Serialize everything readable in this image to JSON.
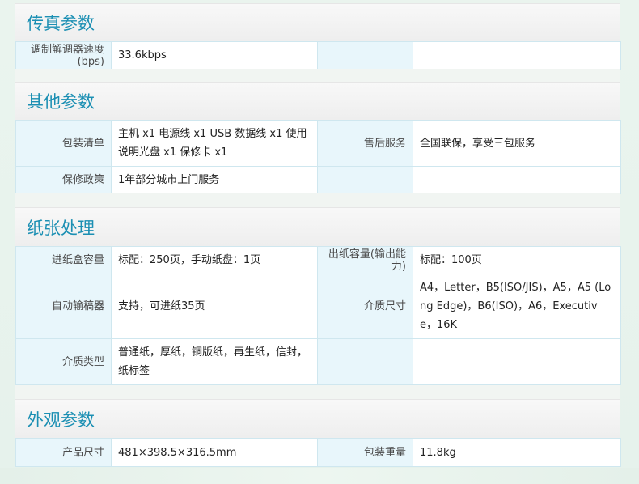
{
  "sections": {
    "fax": {
      "title": "传真参数",
      "rows": [
        {
          "label": "调制解调器速度(bps)",
          "value": "33.6kbps"
        }
      ]
    },
    "other": {
      "title": "其他参数",
      "rows": [
        {
          "label1": "包装清单",
          "value1": "主机 x1 电源线 x1 USB 数据线 x1 使用说明光盘 x1 保修卡 x1",
          "label2": "售后服务",
          "value2": "全国联保，享受三包服务"
        },
        {
          "label1": "保修政策",
          "value1": "1年部分城市上门服务"
        }
      ]
    },
    "paper": {
      "title": "纸张处理",
      "rows": [
        {
          "label1": "进纸盒容量",
          "value1": "标配：250页，手动纸盘：1页",
          "label2": "出纸容量(输出能力)",
          "value2": "标配：100页"
        },
        {
          "label1": "自动输稿器",
          "value1": "支持，可进纸35页",
          "label2": "介质尺寸",
          "value2": "A4，Letter，B5(ISO/JIS)，A5，A5 (Long Edge)，B6(ISO)，A6，Executive，16K"
        },
        {
          "label1": "介质类型",
          "value1": "普通纸，厚纸，铜版纸，再生纸，信封，纸标签"
        }
      ]
    },
    "appearance": {
      "title": "外观参数",
      "rows": [
        {
          "label1": "产品尺寸",
          "value1": "481×398.5×316.5mm",
          "label2": "包装重量",
          "value2": "11.8kg"
        }
      ]
    }
  }
}
